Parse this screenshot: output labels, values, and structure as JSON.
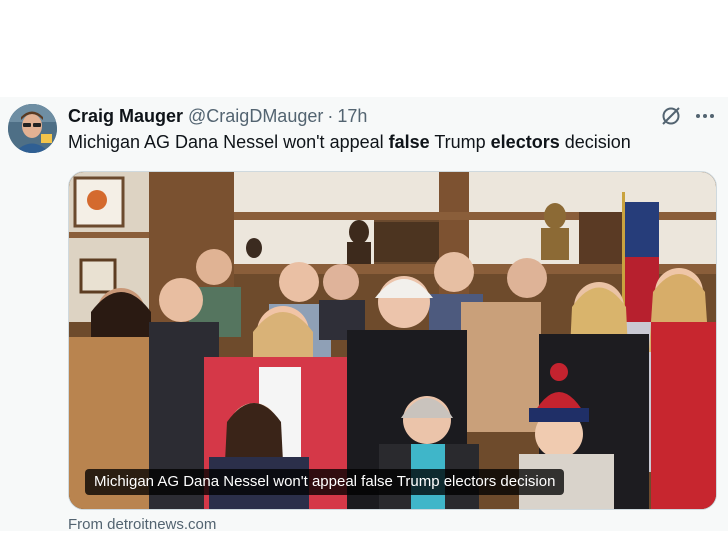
{
  "tweet": {
    "author_name": "Craig Mauger",
    "handle": "@CraigDMauger",
    "separator": "·",
    "time": "17h",
    "text_parts": [
      "Michigan AG Dana Nessel won't appeal ",
      "false",
      " Trump ",
      "electors",
      " decision"
    ],
    "avatar_icon": "user-avatar-photo",
    "grok_icon": "grok-icon",
    "more_icon": "more-options-icon"
  },
  "card": {
    "image_subject": "group-photo",
    "caption": "Michigan AG Dana Nessel won't appeal false Trump electors decision",
    "source": "From detroitnews.com"
  },
  "colors": {
    "background": "#ffffff",
    "tweet_bg": "#f7f9f9",
    "secondary_text": "#536471",
    "primary_text": "#0f1419"
  }
}
